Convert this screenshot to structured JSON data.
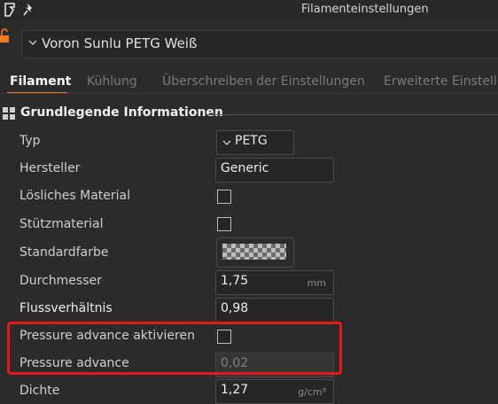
{
  "window": {
    "title": "Filamenteinstellungen"
  },
  "preset": {
    "name": "Voron Sunlu PETG Weiß"
  },
  "tabs": [
    {
      "label": "Filament",
      "active": true
    },
    {
      "label": "Kühlung",
      "active": false
    },
    {
      "label": "Überschreiben der Einstellungen",
      "active": false
    },
    {
      "label": "Erweiterte Einstellu",
      "active": false
    }
  ],
  "section": {
    "title": "Grundlegende Informationen"
  },
  "fields": {
    "typ": {
      "label": "Typ",
      "value": "PETG"
    },
    "hersteller": {
      "label": "Hersteller",
      "value": "Generic"
    },
    "loesliches": {
      "label": "Lösliches Material",
      "checked": false
    },
    "stuetz": {
      "label": "Stützmaterial",
      "checked": false
    },
    "standardfarbe": {
      "label": "Standardfarbe"
    },
    "durchmesser": {
      "label": "Durchmesser",
      "value": "1,75",
      "unit": "mm"
    },
    "fluss": {
      "label": "Flussverhältnis",
      "value": "0,98"
    },
    "pa_enable": {
      "label": "Pressure advance aktivieren",
      "checked": false
    },
    "pa": {
      "label": "Pressure advance",
      "value": "0,02"
    },
    "dichte": {
      "label": "Dichte",
      "value": "1,27",
      "unit": "g/cm³"
    }
  },
  "colors": {
    "accent": "#f07a1f",
    "highlight": "#e21a1a",
    "lock": "#f07a1f"
  }
}
